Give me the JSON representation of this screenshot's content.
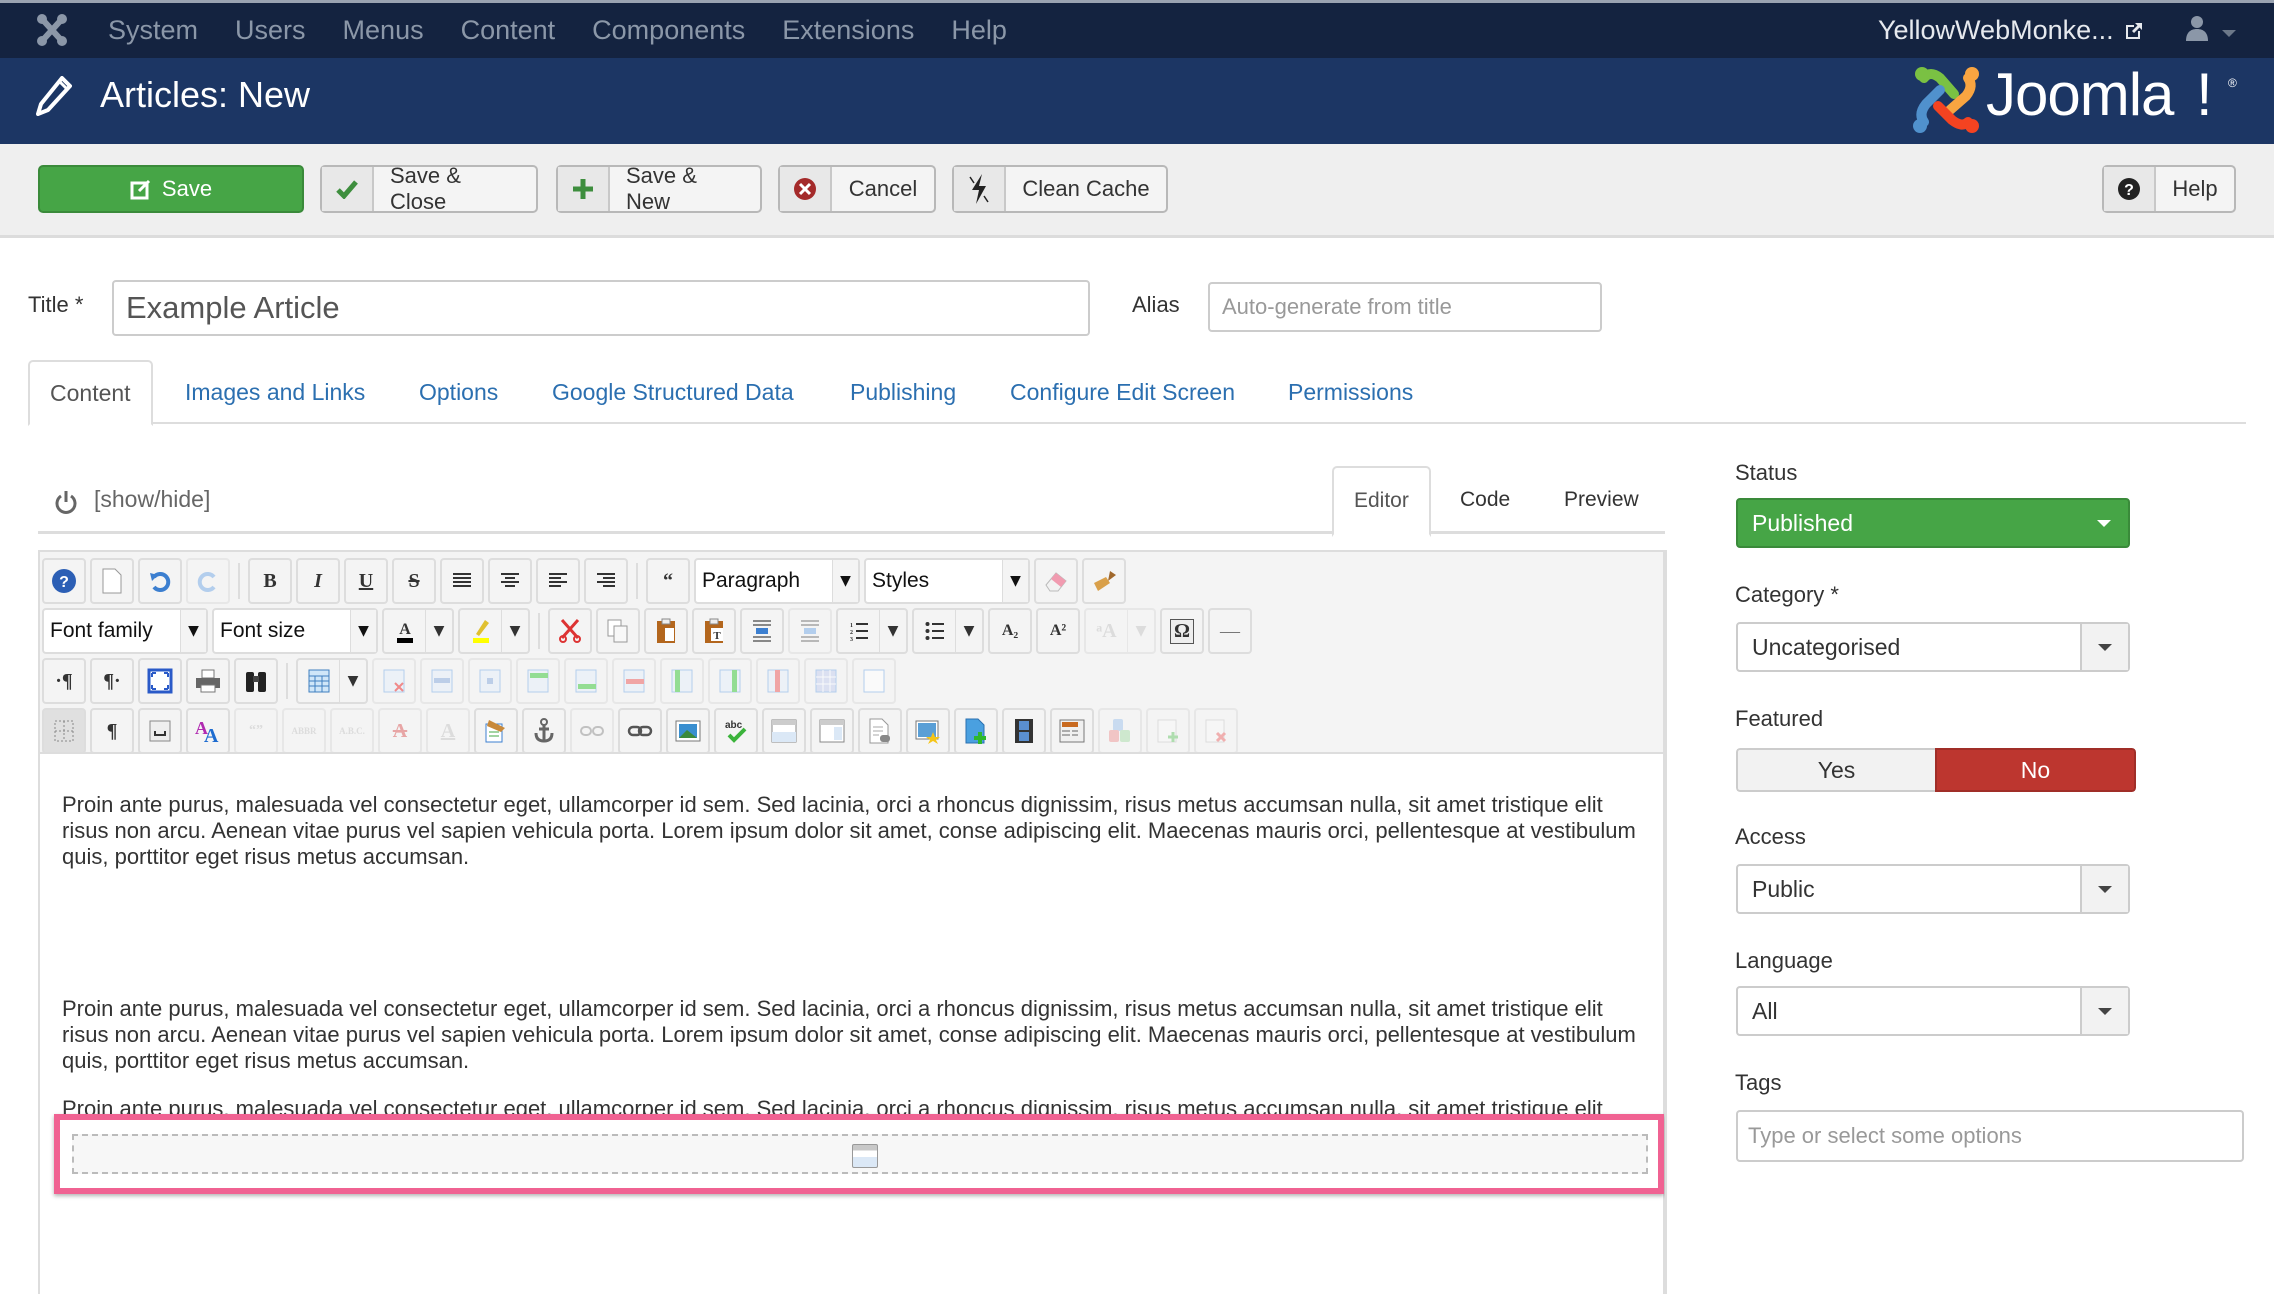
{
  "topnav": {
    "menu": [
      "System",
      "Users",
      "Menus",
      "Content",
      "Components",
      "Extensions",
      "Help"
    ],
    "site_name": "YellowWebMonke...",
    "icons": {
      "logo": "joomla-logo-icon",
      "external": "external-link-icon",
      "user": "user-icon",
      "caret": "caret-down-icon"
    }
  },
  "header": {
    "title": "Articles: New",
    "brand": "Joomla!",
    "brand_text": "Joomla",
    "reg": "®"
  },
  "toolbar": {
    "save": "Save",
    "save_close": "Save & Close",
    "save_new": "Save & New",
    "cancel": "Cancel",
    "clean_cache": "Clean Cache",
    "help": "Help"
  },
  "form": {
    "title_label": "Title *",
    "title_value": "Example Article",
    "alias_label": "Alias",
    "alias_placeholder": "Auto-generate from title"
  },
  "tabs": [
    {
      "label": "Content",
      "active": true
    },
    {
      "label": "Images and Links"
    },
    {
      "label": "Options"
    },
    {
      "label": "Google Structured Data"
    },
    {
      "label": "Publishing"
    },
    {
      "label": "Configure Edit Screen"
    },
    {
      "label": "Permissions"
    }
  ],
  "editor": {
    "show_hide": "[show/hide]",
    "modes": [
      "Editor",
      "Code",
      "Preview"
    ],
    "active_mode": "Editor",
    "format_select": "Paragraph",
    "styles_select": "Styles",
    "font_family": "Font family",
    "font_size": "Font size",
    "glyphs": {
      "bold": "B",
      "italic": "I",
      "underline": "U",
      "strike": "S",
      "blockquote": "“",
      "sub": "A₂",
      "sup": "A²",
      "omega": "Ω",
      "hr": "—",
      "pilcrow": "¶",
      "ltr": "·¶",
      "rtl": "¶·",
      "cite": "“”",
      "abbr": "ABBR",
      "acronym": "A.B.C.",
      "del": "A",
      "ins": "A",
      "translate": "ᵃA",
      "styleprops": "A"
    },
    "paragraphs": [
      "Proin ante purus, malesuada vel consectetur eget, ullamcorper id sem. Sed lacinia, orci a rhoncus dignissim, risus metus accumsan nulla, sit amet tristique elit risus non arcu. Aenean vitae purus vel sapien vehicula porta. Lorem ipsum dolor sit amet, conse adipiscing elit. Maecenas mauris orci, pellentesque at vestibulum quis, porttitor eget risus metus accumsan.",
      "Proin ante purus, malesuada vel consectetur eget, ullamcorper id sem. Sed lacinia, orci a rhoncus dignissim, risus metus accumsan nulla, sit amet tristique elit risus non arcu. Aenean vitae purus vel sapien vehicula porta. Lorem ipsum dolor sit amet, conse adipiscing elit. Maecenas mauris orci, pellentesque at vestibulum quis, porttitor eget risus metus accumsan.",
      "Proin ante purus, malesuada vel consectetur eget, ullamcorper id sem. Sed lacinia, orci a rhoncus dignissim, risus metus accumsan nulla, sit amet tristique elit risus non arcu. Aenean vitae purus vel sapien vehicula porta. Lorem ipsum dolor sit amet, conse adipiscing elit. Maecenas mauris orci, pellentesque at vestibulum quis, porttitor eget risus metus accumsan."
    ],
    "highlight_color": "#f06292"
  },
  "sidebar": {
    "status_label": "Status",
    "status_value": "Published",
    "category_label": "Category *",
    "category_value": "Uncategorised",
    "featured_label": "Featured",
    "featured_yes": "Yes",
    "featured_no": "No",
    "featured_selected": "No",
    "access_label": "Access",
    "access_value": "Public",
    "language_label": "Language",
    "language_value": "All",
    "tags_label": "Tags",
    "tags_placeholder": "Type or select some options"
  },
  "colors": {
    "nav_bg": "#142340",
    "header_bg": "#1c3664",
    "save_green": "#46a546",
    "no_red": "#bd362f",
    "link_blue": "#2b6fb0"
  }
}
